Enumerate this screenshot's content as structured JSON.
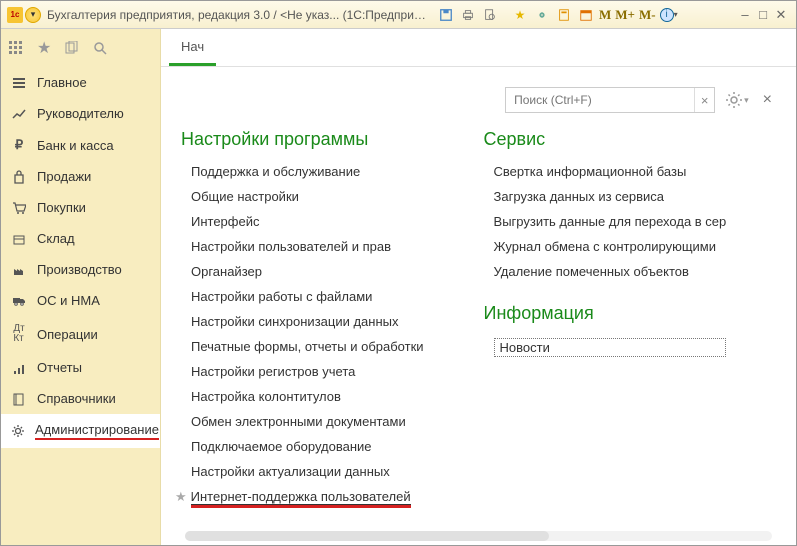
{
  "title": "Бухгалтерия предприятия, редакция 3.0 / <Не указ...   (1С:Предприятие)",
  "toolbar": {
    "m1": "M",
    "m2": "M+",
    "m3": "M-"
  },
  "nav": {
    "items": [
      {
        "icon": "menu",
        "label": "Главное"
      },
      {
        "icon": "trend",
        "label": "Руководителю"
      },
      {
        "icon": "ruble",
        "label": "Банк и касса"
      },
      {
        "icon": "bag",
        "label": "Продажи"
      },
      {
        "icon": "cart",
        "label": "Покупки"
      },
      {
        "icon": "box",
        "label": "Склад"
      },
      {
        "icon": "factory",
        "label": "Производство"
      },
      {
        "icon": "truck",
        "label": "ОС и НМА"
      },
      {
        "icon": "ops",
        "label": "Операции"
      },
      {
        "icon": "report",
        "label": "Отчеты"
      },
      {
        "icon": "book",
        "label": "Справочники"
      },
      {
        "icon": "gear",
        "label": "Администрирование"
      }
    ]
  },
  "tab": {
    "label": "Нач"
  },
  "search": {
    "placeholder": "Поиск (Ctrl+F)"
  },
  "sections": {
    "settings_title": "Настройки программы",
    "settings_links": [
      "Поддержка и обслуживание",
      "Общие настройки",
      "Интерфейс",
      "Настройки пользователей и прав",
      "Органайзер",
      "Настройки работы с файлами",
      "Настройки синхронизации данных",
      "Печатные формы, отчеты и обработки",
      "Настройки регистров учета",
      "Настройка колонтитулов",
      "Обмен электронными документами",
      "Подключаемое оборудование",
      "Настройки актуализации данных"
    ],
    "starred_link": "Интернет-поддержка пользователей",
    "service_title": "Сервис",
    "service_links": [
      "Свертка информационной базы",
      "Загрузка данных из сервиса",
      "Выгрузить данные для перехода в сер",
      "Журнал обмена с контролирующими",
      "Удаление помеченных объектов"
    ],
    "info_title": "Информация",
    "info_link": "Новости"
  }
}
